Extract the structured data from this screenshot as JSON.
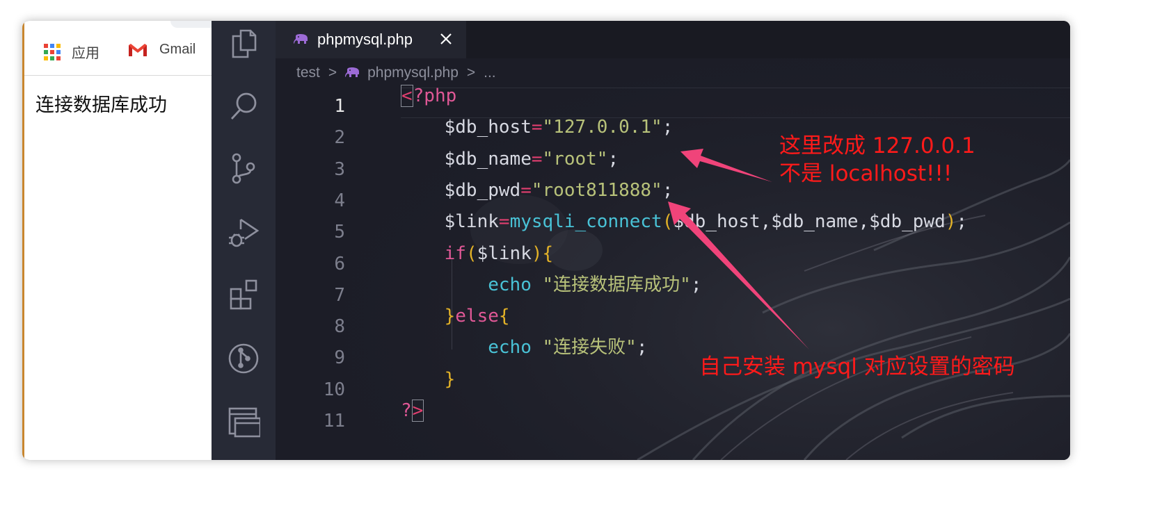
{
  "browser": {
    "bookmarks": [
      {
        "label": "应用",
        "icon": "apps-grid-icon"
      },
      {
        "label": "Gmail",
        "icon": "gmail-icon"
      }
    ],
    "page_text": "连接数据库成功"
  },
  "activity_bar": {
    "icons": [
      "explorer-icon",
      "search-icon",
      "source-control-icon",
      "run-debug-icon",
      "extensions-icon",
      "git-graph-icon",
      "remote-explorer-icon"
    ]
  },
  "editor": {
    "tab": {
      "label": "phpmysql.php",
      "icon": "php-elephant-icon",
      "close_icon": "close-icon"
    },
    "breadcrumb": {
      "folder": "test",
      "sep": ">",
      "file": "phpmysql.php",
      "more": "..."
    },
    "line_numbers": [
      "1",
      "2",
      "3",
      "4",
      "5",
      "6",
      "7",
      "8",
      "9",
      "10",
      "11"
    ],
    "current_line": 1,
    "code": [
      [
        [
          "tag",
          "<"
        ],
        [
          "kw",
          "?php"
        ]
      ],
      [
        [
          "ws",
          "    "
        ],
        [
          "var",
          "$db_host"
        ],
        [
          "op",
          "="
        ],
        [
          "str",
          "\"127.0.0.1\""
        ],
        [
          "pn",
          ";"
        ]
      ],
      [
        [
          "ws",
          "    "
        ],
        [
          "var",
          "$db_name"
        ],
        [
          "op",
          "="
        ],
        [
          "str",
          "\"root\""
        ],
        [
          "pn",
          ";"
        ]
      ],
      [
        [
          "ws",
          "    "
        ],
        [
          "var",
          "$db_pwd"
        ],
        [
          "op",
          "="
        ],
        [
          "str",
          "\"root811888\""
        ],
        [
          "pn",
          ";"
        ]
      ],
      [
        [
          "ws",
          "    "
        ],
        [
          "var",
          "$link"
        ],
        [
          "op",
          "="
        ],
        [
          "fn",
          "mysqli_connect"
        ],
        [
          "br",
          "("
        ],
        [
          "var",
          "$db_host"
        ],
        [
          "pn",
          ","
        ],
        [
          "var",
          "$db_name"
        ],
        [
          "pn",
          ","
        ],
        [
          "var",
          "$db_pwd"
        ],
        [
          "br",
          ")"
        ],
        [
          "pn",
          ";"
        ]
      ],
      [
        [
          "ws",
          "    "
        ],
        [
          "kw",
          "if"
        ],
        [
          "br",
          "("
        ],
        [
          "var",
          "$link"
        ],
        [
          "br",
          "){"
        ]
      ],
      [
        [
          "ws",
          "        "
        ],
        [
          "echo",
          "echo"
        ],
        [
          "ws",
          " "
        ],
        [
          "str",
          "\"连接数据库成功\""
        ],
        [
          "pn",
          ";"
        ]
      ],
      [
        [
          "ws",
          "    "
        ],
        [
          "br",
          "}"
        ],
        [
          "kw",
          "else"
        ],
        [
          "br",
          "{"
        ]
      ],
      [
        [
          "ws",
          "        "
        ],
        [
          "echo",
          "echo"
        ],
        [
          "ws",
          " "
        ],
        [
          "str",
          "\"连接失败\""
        ],
        [
          "pn",
          ";"
        ]
      ],
      [
        [
          "ws",
          "    "
        ],
        [
          "br",
          "}"
        ]
      ],
      [
        [
          "kw",
          "?"
        ],
        [
          "tag",
          ">"
        ]
      ]
    ]
  },
  "annotations": {
    "host_note": "这里改成 127.0.0.1\n不是 localhost!!!",
    "pwd_note": "自己安装 mysql 对应设置的密码",
    "color": "#ff1a1a"
  },
  "colors": {
    "editor_bg": "#1c1d27",
    "activity_bg": "#272a36",
    "keyword": "#e05896",
    "string": "#b8c27a",
    "function": "#49c2d6",
    "bracket": "#e3b227",
    "arrow": "#f0447a"
  }
}
